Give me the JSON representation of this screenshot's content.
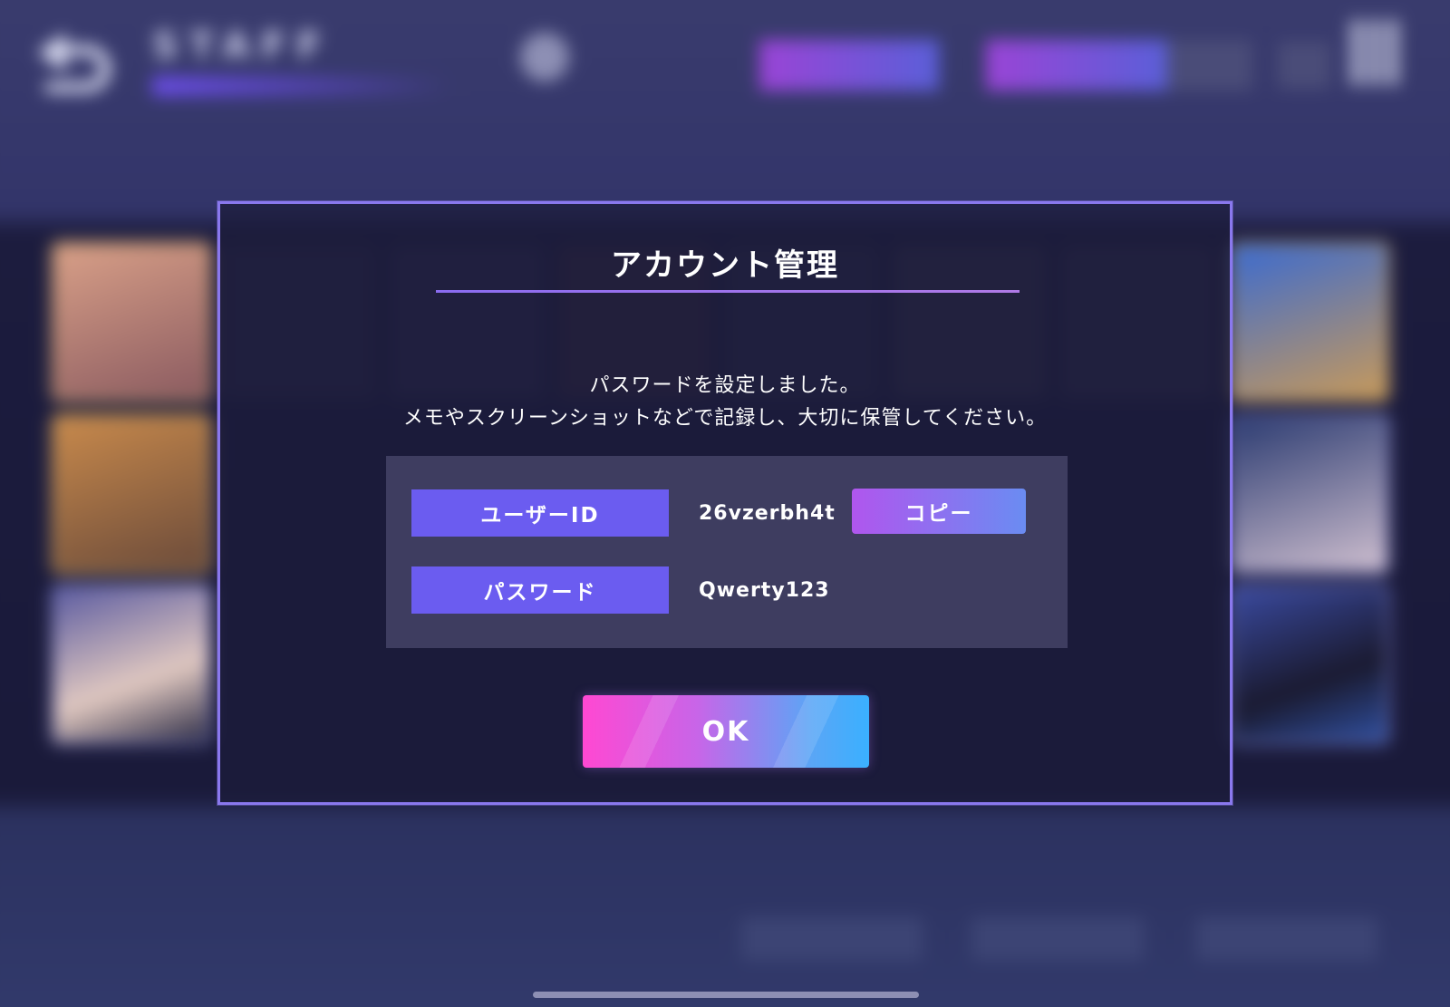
{
  "background": {
    "header_label": "STAFF"
  },
  "dialog": {
    "title": "アカウント管理",
    "message_line1": "パスワードを設定しました。",
    "message_line2": "メモやスクリーンショットなどで記録し、大切に保管してください。",
    "user_id_label": "ユーザーID",
    "user_id_value": "26vzerbh4t",
    "copy_label": "コピー",
    "password_label": "パスワード",
    "password_value": "Qwerty123",
    "ok_label": "OK"
  },
  "colors": {
    "dialog_border": "#8a78ee",
    "label_fill": "#6b5cf0",
    "copy_gradient_start": "#b056ee",
    "copy_gradient_end": "#6a8cf2",
    "ok_gradient_start": "#ff48d2",
    "ok_gradient_end": "#3ab0ff"
  }
}
